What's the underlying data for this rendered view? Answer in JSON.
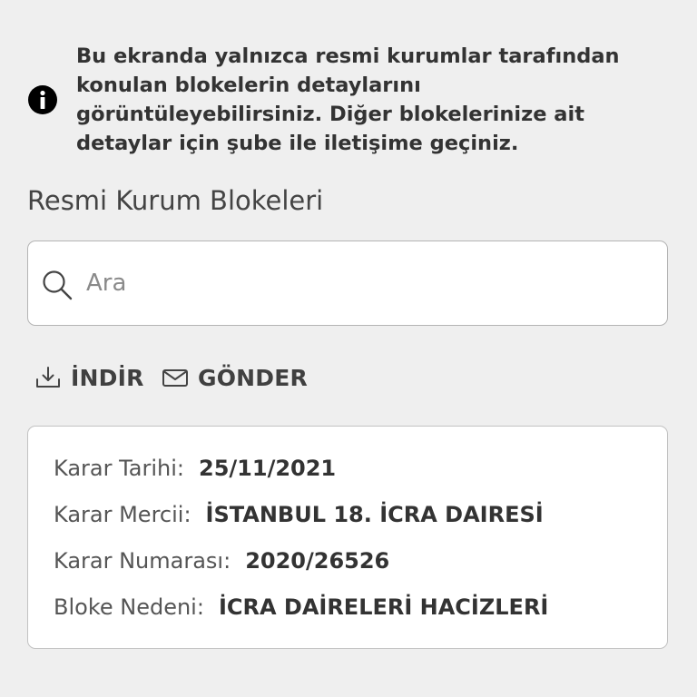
{
  "notice": {
    "icon": "info-icon",
    "text": "Bu ekranda yalnızca resmi kurumlar tarafından konulan blokelerin detaylarını görüntüleyebilirsiniz. Diğer blokelerinize ait detaylar için şube ile iletişime geçiniz."
  },
  "section_title": "Resmi Kurum Blokeleri",
  "search": {
    "icon": "search-icon",
    "placeholder": "Ara",
    "value": ""
  },
  "actions": {
    "download": {
      "icon": "download-icon",
      "label": "İNDİR"
    },
    "send": {
      "icon": "mail-icon",
      "label": "GÖNDER"
    }
  },
  "block_detail": {
    "decision_date": {
      "label": "Karar Tarihi:",
      "value": "25/11/2021"
    },
    "decision_authority": {
      "label": "Karar Mercii:",
      "value": "İSTANBUL 18. İCRA DAIRESİ"
    },
    "decision_number": {
      "label": "Karar Numarası:",
      "value": "2020/26526"
    },
    "block_reason": {
      "label": "Bloke Nedeni:",
      "value": "İCRA DAİRELERİ HACİZLERİ"
    }
  }
}
